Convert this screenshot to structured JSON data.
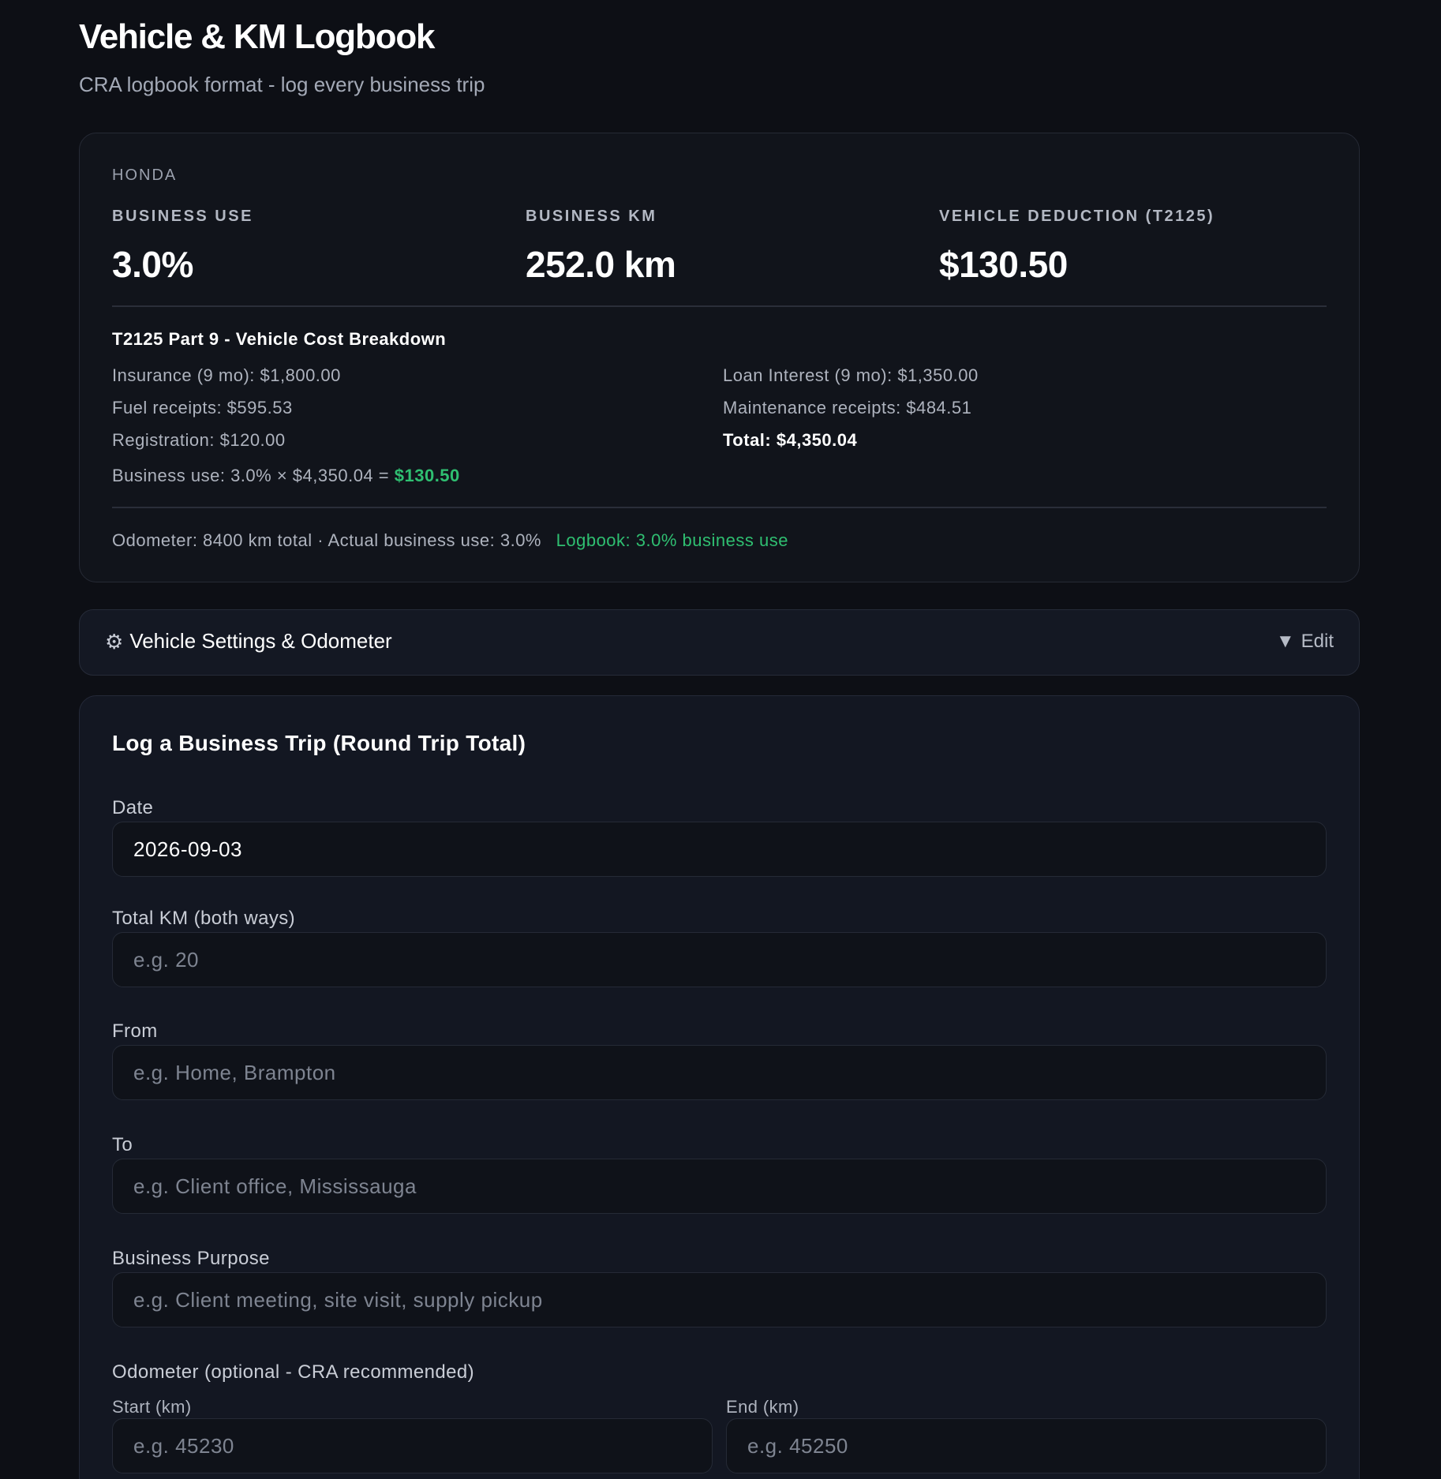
{
  "header": {
    "title": "Vehicle & KM Logbook",
    "subtitle": "CRA logbook format - log every business trip"
  },
  "summary": {
    "vehicle_name": "HONDA",
    "stats": [
      {
        "label": "BUSINESS USE",
        "value": "3.0%"
      },
      {
        "label": "BUSINESS KM",
        "value": "252.0 km"
      },
      {
        "label": "VEHICLE DEDUCTION (T2125)",
        "value": "$130.50"
      }
    ],
    "breakdown": {
      "title": "T2125 Part 9 - Vehicle Cost Breakdown",
      "left": [
        "Insurance (9 mo): $1,800.00",
        "Fuel receipts: $595.53",
        "Registration: $120.00"
      ],
      "right": [
        "Loan Interest (9 mo): $1,350.00",
        "Maintenance receipts: $484.51",
        "Total: $4,350.04"
      ],
      "business_use_prefix": "Business use: 3.0% × $4,350.04 = ",
      "business_use_amount": "$130.50"
    },
    "odometer_note": "Odometer: 8400 km total · Actual business use: 3.0%",
    "logbook_note": "Logbook: 3.0% business use"
  },
  "settings": {
    "label": "Vehicle Settings & Odometer",
    "edit_icon": "▼",
    "edit_label": "Edit"
  },
  "form": {
    "title": "Log a Business Trip (Round Trip Total)",
    "date": {
      "label": "Date",
      "value": "2026-09-03"
    },
    "km": {
      "label": "Total KM (both ways)",
      "placeholder": "e.g. 20"
    },
    "from": {
      "label": "From",
      "placeholder": "e.g. Home, Brampton"
    },
    "to": {
      "label": "To",
      "placeholder": "e.g. Client office, Mississauga"
    },
    "purpose": {
      "label": "Business Purpose",
      "placeholder": "e.g. Client meeting, site visit, supply pickup"
    },
    "odometer": {
      "label": "Odometer (optional - CRA recommended)",
      "start_label": "Start (km)",
      "start_placeholder": "e.g. 45230",
      "end_label": "End (km)",
      "end_placeholder": "e.g. 45250"
    }
  },
  "colors": {
    "background": "#0d0f15",
    "accent_green": "#2fbf71"
  }
}
